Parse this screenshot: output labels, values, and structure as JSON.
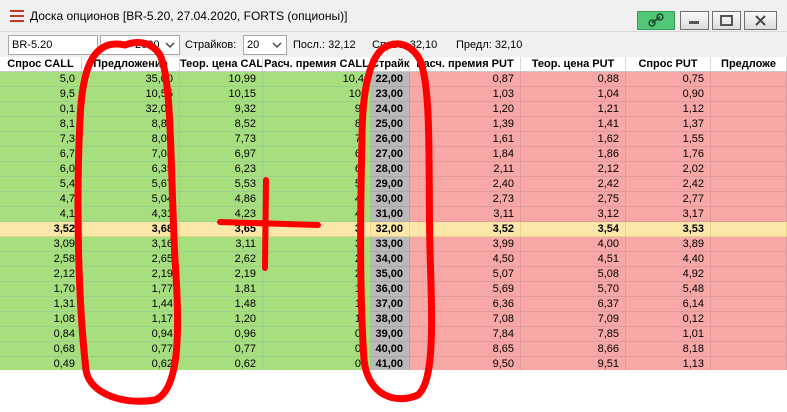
{
  "window": {
    "title": "Доска опционов [BR-5.20, 27.04.2020, FORTS (опционы)]",
    "link_button_color": "#52c777"
  },
  "toolbar": {
    "instrument": "BR-5.20",
    "expiry": "2020",
    "strikes_label": "Страйков:",
    "strikes_value": "20",
    "last_label": "Посл.: 32,12",
    "demand_label": "Спрос: 32,10",
    "prev_label": "Предл: 32,10"
  },
  "columns": [
    "Спрос CALL",
    "Предложение",
    "Теор. цена CALL",
    "Расч. премия CALL",
    "Страйк",
    "Расч. премия PUT",
    "Теор. цена PUT",
    "Спрос PUT",
    "Предложе"
  ],
  "rows": [
    {
      "c": [
        "5,0",
        "35,00",
        "10,99",
        "10,4",
        "22,00",
        "0,87",
        "0,88",
        "0,75",
        ""
      ]
    },
    {
      "c": [
        "9,5",
        "10,55",
        "10,15",
        "10,",
        "23,00",
        "1,03",
        "1,04",
        "0,90",
        ""
      ]
    },
    {
      "c": [
        "0,1",
        "32,00",
        "9,32",
        "9,",
        "24,00",
        "1,20",
        "1,21",
        "1,12",
        ""
      ]
    },
    {
      "c": [
        "8,1",
        "8,80",
        "8,52",
        "8,",
        "25,00",
        "1,39",
        "1,41",
        "1,37",
        ""
      ]
    },
    {
      "c": [
        "7,3",
        "8,08",
        "7,73",
        "7,",
        "26,00",
        "1,61",
        "1,62",
        "1,55",
        ""
      ]
    },
    {
      "c": [
        "6,7",
        "7,08",
        "6,97",
        "6,",
        "27,00",
        "1,84",
        "1,86",
        "1,76",
        ""
      ]
    },
    {
      "c": [
        "6,0",
        "6,35",
        "6,23",
        "6,",
        "28,00",
        "2,11",
        "2,12",
        "2,02",
        ""
      ]
    },
    {
      "c": [
        "5,4",
        "5,67",
        "5,53",
        "5,",
        "29,00",
        "2,40",
        "2,42",
        "2,42",
        ""
      ]
    },
    {
      "c": [
        "4,7",
        "5,04",
        "4,86",
        "4,",
        "30,00",
        "2,73",
        "2,75",
        "2,77",
        ""
      ]
    },
    {
      "c": [
        "4,1",
        "4,31",
        "4,23",
        "4,",
        "31,00",
        "3,11",
        "3,12",
        "3,17",
        ""
      ]
    },
    {
      "c": [
        "3,52",
        "3,68",
        "3,65",
        "3,",
        "32,00",
        "3,52",
        "3,54",
        "3,53",
        ""
      ],
      "atm": true
    },
    {
      "c": [
        "3,09",
        "3,16",
        "3,11",
        "3,",
        "33,00",
        "3,99",
        "4,00",
        "3,89",
        ""
      ]
    },
    {
      "c": [
        "2,58",
        "2,65",
        "2,62",
        "2,",
        "34,00",
        "4,50",
        "4,51",
        "4,40",
        ""
      ]
    },
    {
      "c": [
        "2,12",
        "2,19",
        "2,19",
        "2,",
        "35,00",
        "5,07",
        "5,08",
        "4,92",
        ""
      ]
    },
    {
      "c": [
        "1,70",
        "1,77",
        "1,81",
        "1,",
        "36,00",
        "5,69",
        "5,70",
        "5,48",
        ""
      ]
    },
    {
      "c": [
        "1,31",
        "1,44",
        "1,48",
        "1,",
        "37,00",
        "6,36",
        "6,37",
        "6,14",
        ""
      ]
    },
    {
      "c": [
        "1,08",
        "1,17",
        "1,20",
        "1,",
        "38,00",
        "7,08",
        "7,09",
        "0,12",
        ""
      ]
    },
    {
      "c": [
        "0,84",
        "0,94",
        "0,96",
        "0,",
        "39,00",
        "7,84",
        "7,85",
        "1,01",
        ""
      ]
    },
    {
      "c": [
        "0,68",
        "0,77",
        "0,77",
        "0,",
        "40,00",
        "8,65",
        "8,66",
        "8,18",
        ""
      ]
    },
    {
      "c": [
        "0,49",
        "0,62",
        "0,62",
        "0,",
        "41,00",
        "9,50",
        "9,51",
        "1,13",
        ""
      ],
      "last": true
    }
  ],
  "colors": {
    "call_bg": "#a7df7f",
    "put_bg": "#f7a8a6",
    "strike_bg": "#b9b9b9",
    "atm_bg": "#fbe7aa",
    "annotation": "#ff0000"
  }
}
